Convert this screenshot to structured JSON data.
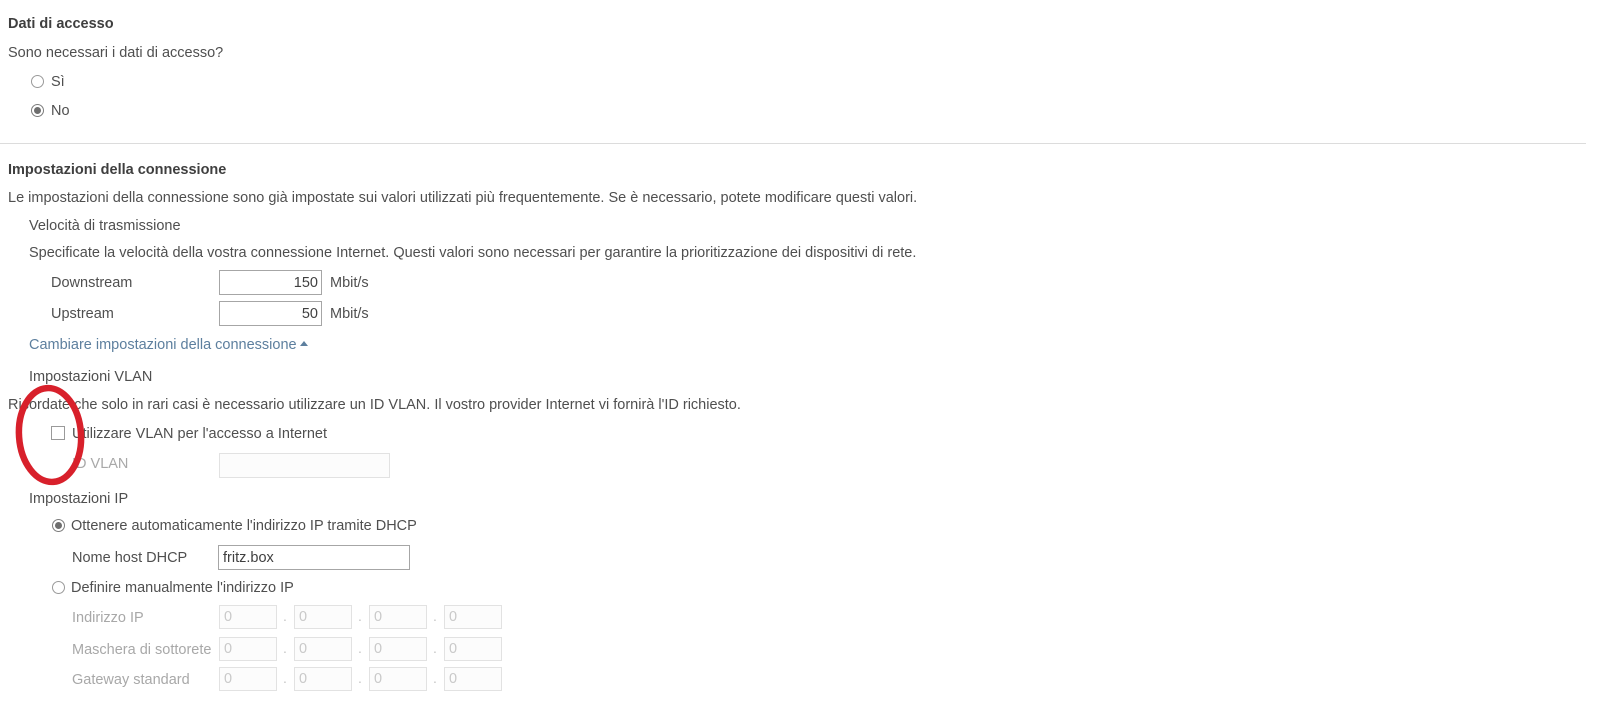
{
  "access_data": {
    "section_title": "Dati di accesso",
    "question": "Sono necessari i dati di accesso?",
    "options": [
      {
        "label": "Sì",
        "selected": false
      },
      {
        "label": "No",
        "selected": true
      }
    ]
  },
  "connection_settings": {
    "section_title": "Impostazioni della connessione",
    "description": "Le impostazioni della connessione sono già impostate sui valori utilizzati più frequentemente. Se è necessario, potete modificare questi valori.",
    "transmission_speed": {
      "heading": "Velocità di trasmissione",
      "description": "Specificate la velocità della vostra connessione Internet. Questi valori sono necessari per garantire la prioritizzazione dei dispositivi di rete.",
      "downstream": {
        "label": "Downstream",
        "value": "150",
        "unit": "Mbit/s"
      },
      "upstream": {
        "label": "Upstream",
        "value": "50",
        "unit": "Mbit/s"
      }
    },
    "change_link": "Cambiare impostazioni della connessione"
  },
  "vlan_settings": {
    "heading": "Impostazioni VLAN",
    "description": "Ricordate che solo in rari casi è necessario utilizzare un ID VLAN. Il vostro provider Internet vi fornirà l'ID richiesto.",
    "use_vlan": {
      "label": "Utilizzare VLAN per l'accesso a Internet",
      "checked": false
    },
    "vlan_id": {
      "label": "ID VLAN",
      "value": "",
      "disabled": true
    }
  },
  "ip_settings": {
    "heading": "Impostazioni IP",
    "dhcp_option": {
      "label": "Ottenere automaticamente l'indirizzo IP tramite DHCP",
      "selected": true
    },
    "dhcp_hostname": {
      "label": "Nome host DHCP",
      "value": "fritz.box"
    },
    "manual_option": {
      "label": "Definire manualmente l'indirizzo IP",
      "selected": false
    },
    "ip_address": {
      "label": "Indirizzo IP",
      "octets": [
        "0",
        "0",
        "0",
        "0"
      ],
      "disabled": true
    },
    "subnet_mask": {
      "label": "Maschera di sottorete",
      "octets": [
        "0",
        "0",
        "0",
        "0"
      ],
      "disabled": true
    },
    "default_gateway": {
      "label": "Gateway standard",
      "octets": [
        "0",
        "0",
        "0",
        "0"
      ],
      "disabled": true
    },
    "octet_separator": "."
  },
  "annotation": {
    "type": "ellipse-highlight",
    "color": "#d8202b",
    "target": "vlan-checkbox"
  }
}
